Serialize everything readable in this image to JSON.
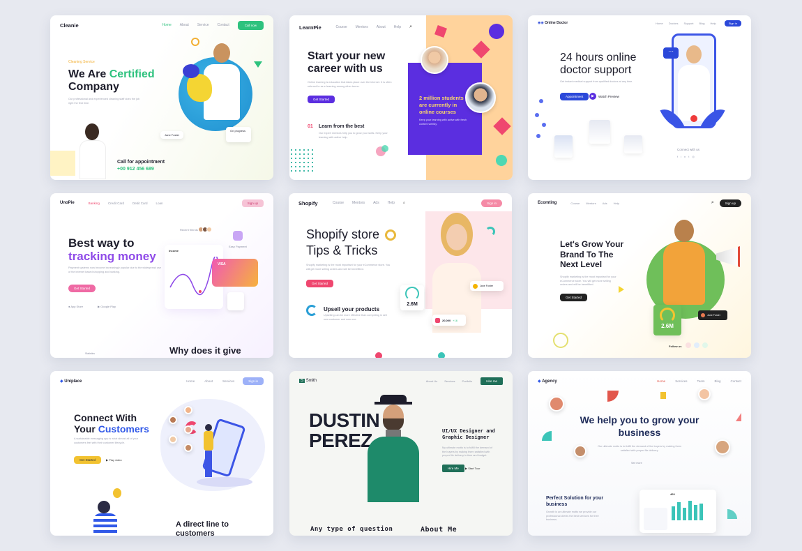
{
  "cards": {
    "cleanie": {
      "logo": "Cleanie",
      "nav": [
        "Home",
        "About",
        "Service",
        "Contact"
      ],
      "cta": "Call now",
      "eyebrow": "Cleaning Service",
      "title_1": "We Are ",
      "title_hl": "Certified",
      "title_2": "Company",
      "desc": "Our professional and experienced cleaning staff does the job right the first time.",
      "badge_1": "Jane Foster",
      "badge_2": "On progress",
      "call_title": "Call for appointment",
      "call_phone": "+00 912 456 689",
      "accent": "#2ec27e"
    },
    "learnpie": {
      "logo": "LearnPie",
      "nav": [
        "Course",
        "Mentors",
        "About",
        "Help"
      ],
      "title": "Start your new career with us",
      "desc": "Online learning is education that takes place over the internet. It is often referred to as e-learning among other terms.",
      "cta": "Get Started",
      "step_num": "01",
      "step_title": "Learn from the best",
      "step_desc": "Our expert mentors help you to grow your skills. Keep your learning with active help.",
      "stat": "2 million students are currently in online courses",
      "stat_sub": "Keep your learning with active with fresh content weekly.",
      "accent": "#5b2ee0"
    },
    "doctor": {
      "logo": "Online Doctor",
      "nav": [
        "Home",
        "Doctors",
        "Support",
        "Blog",
        "Help"
      ],
      "cta": "Sign in",
      "title": "24 hours online doctor support",
      "desc": "Get instant medical support from qualified doctors at any time.",
      "btn_primary": "Appointment",
      "btn_secondary": "Watch Preview",
      "connect": "Connect with us",
      "accent": "#2b48d9"
    },
    "unopie": {
      "logo": "UnoPie",
      "nav": [
        "Banking",
        "Credit Card",
        "Debit Card",
        "Loan"
      ],
      "cta": "Sign up",
      "title_1": "Best way to",
      "title_2": "tracking money",
      "desc": "Payment systems now become increasingly popular due to the widespread use of the internet based shopping and banking.",
      "btn": "Get Started",
      "store_1": "App Store",
      "store_2": "Google Play",
      "income_label": "Income",
      "recent": "Recent friends",
      "pay": "Easy Payment",
      "card_brand": "VISA",
      "footer_1": "Statistics",
      "bottom_heading": "Why does it give",
      "accent": "#8f4be8"
    },
    "shopify": {
      "logo": "Shopify",
      "nav": [
        "Course",
        "Mentors",
        "Ads",
        "Help"
      ],
      "cta": "Sign in",
      "title": "Shopify store Tips & Tricks",
      "desc": "Shopify marketing is the most important for your eCommerce store. You will get more selling orders and will be benefitted.",
      "btn": "Get Started",
      "upsell_title": "Upsell your products",
      "upsell_desc": "Upselling can be more effective than competing in sell new customer and new one.",
      "stat_big": "2.6M",
      "stat_small": "20,000",
      "stat_pct": "+16",
      "name_tag": "Jane Foster",
      "accent": "#ef476f"
    },
    "ecomting": {
      "logo": "Ecomting",
      "nav": [
        "Course",
        "Mentors",
        "Ads",
        "Help"
      ],
      "cta": "Sign up",
      "title": "Let's Grow Your Brand To The Next Level",
      "desc": "Shopify marketing is the most important for your eCommerce store. You will get more selling orders and will be benefitted.",
      "btn": "Get Started",
      "stat": "2.6M",
      "name_tag": "Jane Foster",
      "follow": "Follow us",
      "accent": "#6fbf5a"
    },
    "uniplace": {
      "logo": "Uniplace",
      "nav": [
        "Home",
        "About",
        "Services"
      ],
      "cta": "Sign in",
      "title_1": "Connect With",
      "title_2": "Your ",
      "title_hl": "Customers",
      "desc": "A sustainable messaging app is what almost all of your customers feel with their customer lifecycle.",
      "btn_primary": "Get Started",
      "btn_secondary": "Play video",
      "bottom_heading": "A direct line to customers",
      "accent": "#3159e8"
    },
    "smith": {
      "logo": "Smith",
      "nav": [
        "About Us",
        "Services",
        "Portfolio"
      ],
      "cta": "Hire me",
      "name_1": "DUSTIN",
      "name_2": "PEREZ",
      "role": "UI/UX Designer and Graphic Designer",
      "desc": "My ultimate motto is to fulfill the demand of the buyers by making them satisfied with proper file delivery in time and budget.",
      "btn_primary": "Hire Me",
      "btn_secondary": "Start Tour",
      "footer_left": "Any type of question",
      "footer_right": "About Me",
      "accent": "#1f6f58"
    },
    "agency": {
      "logo": "Agency",
      "nav": [
        "Home",
        "Services",
        "Team",
        "Blog",
        "Contact"
      ],
      "title": "We help you to grow your business",
      "desc": "Our ultimate motto is to fulfill the demand of the buyers by making them satisfied with proper file delivery.",
      "link": "See more",
      "solution_title": "Perfect Solution for your business",
      "solution_desc": "Growth is an ultimate motto we provide our professional clients the best services for their business.",
      "stat": "460",
      "accent": "#e2574c"
    }
  }
}
